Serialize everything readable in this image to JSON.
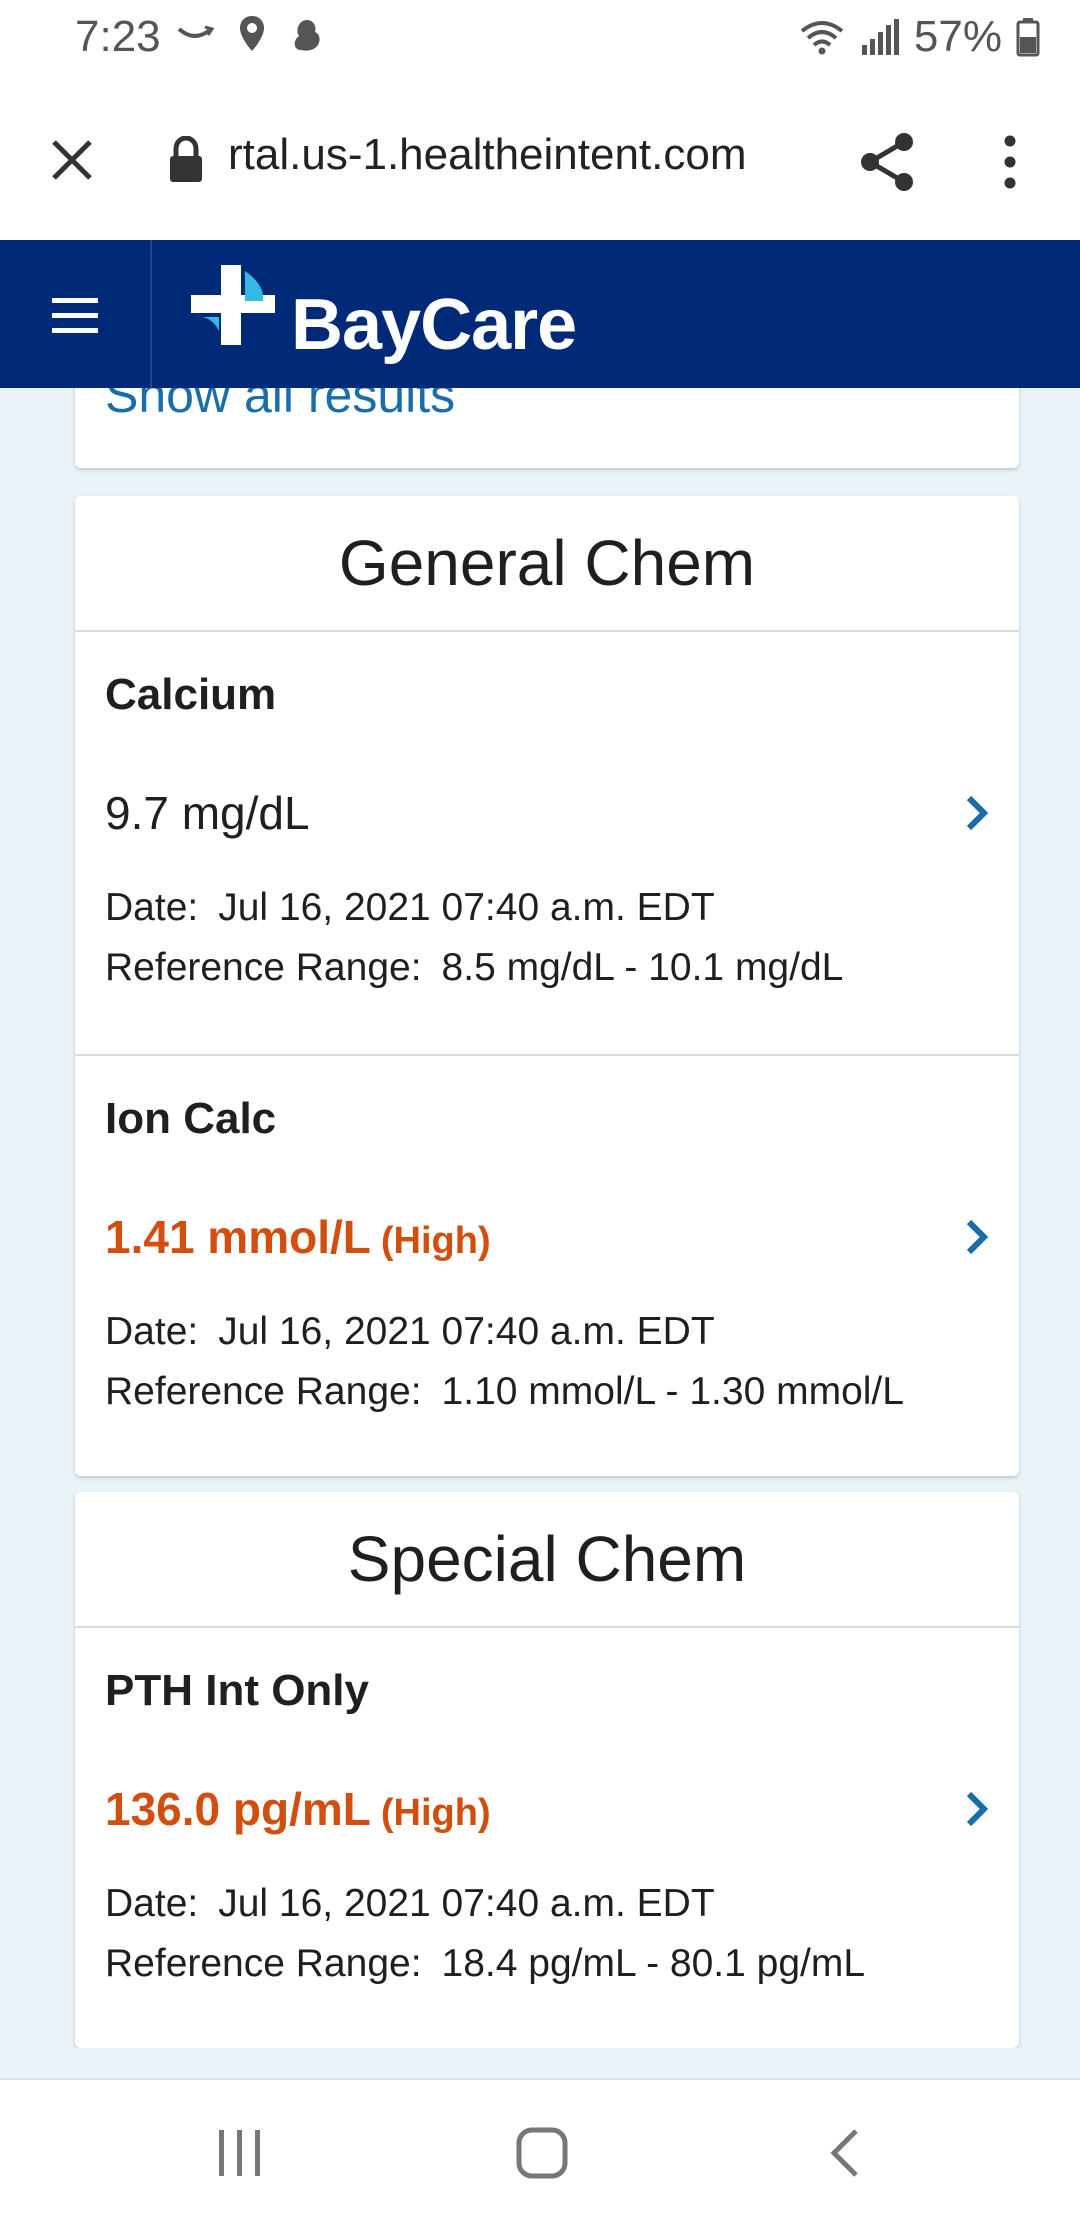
{
  "status_bar": {
    "time": "7:23",
    "battery": "57%"
  },
  "browser": {
    "url": "rtal.us-1.healtheintent.com"
  },
  "header": {
    "brand": "BayCare"
  },
  "top_card": {
    "link": "Show all results"
  },
  "sections": [
    {
      "title": "General Chem",
      "results": [
        {
          "name": "Calcium",
          "value": "9.7 mg/dL",
          "flag": "",
          "date_label": "Date:",
          "date": "Jul 16, 2021 07:40 a.m. EDT",
          "range_label": "Reference Range:",
          "range": "8.5 mg/dL - 10.1 mg/dL"
        },
        {
          "name": "Ion Calc",
          "value": "1.41 mmol/L",
          "flag": "(High)",
          "date_label": "Date:",
          "date": "Jul 16, 2021 07:40 a.m. EDT",
          "range_label": "Reference Range:",
          "range": "1.10 mmol/L - 1.30 mmol/L"
        }
      ]
    },
    {
      "title": "Special Chem",
      "results": [
        {
          "name": "PTH Int Only",
          "value": "136.0 pg/mL",
          "flag": "(High)",
          "date_label": "Date:",
          "date": "Jul 16, 2021 07:40 a.m. EDT",
          "range_label": "Reference Range:",
          "range": "18.4 pg/mL - 80.1 pg/mL"
        }
      ]
    }
  ],
  "colors": {
    "header_bg": "#002a77",
    "link": "#1a6ea8",
    "high": "#d24e0e",
    "page_bg": "#eaf3f8"
  }
}
